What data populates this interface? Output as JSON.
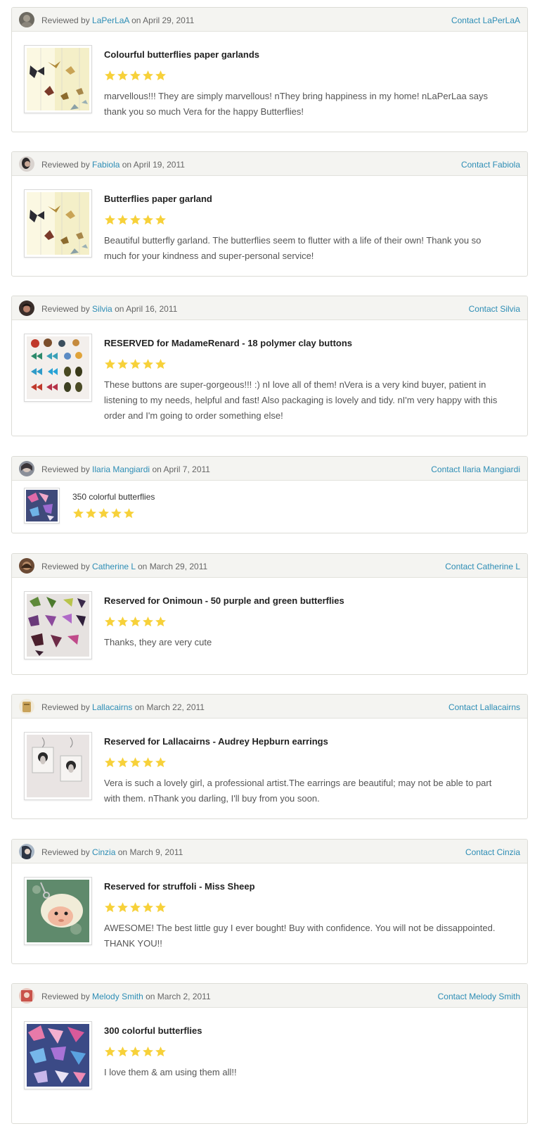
{
  "labels": {
    "reviewed_by": "Reviewed by",
    "on": "on",
    "contact_prefix": "Contact"
  },
  "colors": {
    "star": "#f7d13a",
    "link": "#2d8db5",
    "header_bg": "#f4f4f1"
  },
  "reviews": [
    {
      "reviewer": "LaPerLaA",
      "date": "April 29, 2011",
      "contact": "Contact LaPerLaA",
      "item": "Colourful butterflies paper garlands",
      "rating": 5,
      "text": "marvellous!!! They are simply marvellous! nThey bring happiness in my home! nLaPerLaa says thank you so much Vera for the happy Butterflies!",
      "image_icon": "butterfly-garland-photo",
      "avatar_icon": "avatar-photo"
    },
    {
      "reviewer": "Fabiola",
      "date": "April 19, 2011",
      "contact": "Contact Fabiola",
      "item": "Butterflies paper garland",
      "rating": 5,
      "text": "Beautiful butterfly garland. The butterflies seem to flutter with a life of their own! Thank you so much for your kindness and super-personal service!",
      "image_icon": "butterfly-garland-photo",
      "avatar_icon": "avatar-photo"
    },
    {
      "reviewer": "Silvia",
      "date": "April 16, 2011",
      "contact": "Contact Silvia",
      "item": "RESERVED for MadameRenard - 18 polymer clay buttons",
      "rating": 5,
      "text": "These buttons are super-gorgeous!!! :) nI love all of them! nVera is a very kind buyer, patient in listening to my needs, helpful and fast! Also packaging is lovely and tidy. nI'm very happy with this order and I'm going to order something else!",
      "image_icon": "clay-buttons-photo",
      "avatar_icon": "avatar-photo"
    },
    {
      "reviewer": "Ilaria Mangiardi",
      "date": "April 7, 2011",
      "contact": "Contact Ilaria Mangiardi",
      "item": "350 colorful butterflies",
      "rating": 5,
      "text": "",
      "image_icon": "colorful-butterflies-photo",
      "avatar_icon": "avatar-photo"
    },
    {
      "reviewer": "Catherine L",
      "date": "March 29, 2011",
      "contact": "Contact Catherine L",
      "item": "Reserved for Onimoun - 50 purple and green butterflies",
      "rating": 5,
      "text": "Thanks, they are very cute",
      "image_icon": "purple-butterflies-photo",
      "avatar_icon": "avatar-photo"
    },
    {
      "reviewer": "Lallacairns",
      "date": "March 22, 2011",
      "contact": "Contact Lallacairns",
      "item": "Reserved for Lallacairns - Audrey Hepburn earrings",
      "rating": 5,
      "text": "Vera is such a lovely girl, a professional artist.The earrings are beautiful; may not be able to part with them. nThank you darling, I'll buy from you soon.",
      "image_icon": "earrings-photo",
      "avatar_icon": "avatar-photo"
    },
    {
      "reviewer": "Cinzia",
      "date": "March 9, 2011",
      "contact": "Contact Cinzia",
      "item": "Reserved for struffoli - Miss Sheep",
      "rating": 5,
      "text": "AWESOME! The best little guy I ever bought! Buy with confidence. You will not be dissappointed. THANK YOU!!",
      "image_icon": "sheep-charm-photo",
      "avatar_icon": "avatar-photo"
    },
    {
      "reviewer": "Melody Smith",
      "date": "March 2, 2011",
      "contact": "Contact Melody Smith",
      "item": "300 colorful butterflies",
      "rating": 5,
      "text": "I love them & am using them all!!",
      "image_icon": "colorful-butterflies-photo",
      "avatar_icon": "avatar-photo"
    }
  ]
}
